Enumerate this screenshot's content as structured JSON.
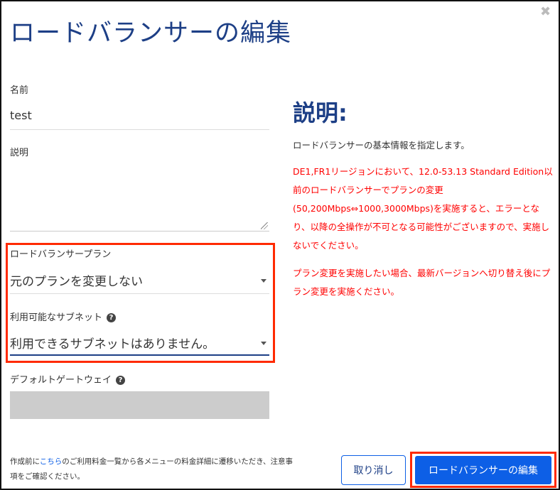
{
  "dialog": {
    "title": "ロードバランサーの編集",
    "close_icon": "✖"
  },
  "form": {
    "name_label": "名前",
    "name_value": "test",
    "description_label": "説明",
    "description_value": "",
    "plan_label": "ロードバランサープラン",
    "plan_value": "元のプランを変更しない",
    "subnet_label": "利用可能なサブネット",
    "subnet_value": "利用できるサブネットはありません。",
    "gateway_label": "デフォルトゲートウェイ",
    "gateway_value": "",
    "help_icon": "?"
  },
  "help": {
    "heading": "説明:",
    "text": "ロードバランサーの基本情報を指定します。",
    "warning1": "DE1,FR1リージョンにおいて、12.0-53.13 Standard Edition以前のロードバランサーでプランの変更(50,200Mbps⇔1000,3000Mbps)を実施すると、エラーとなり、以降の全操作が不可となる可能性がございますので、実施しないでください。",
    "warning2": "プラン変更を実施したい場合、最新バージョンへ切り替え後にプラン変更を実施ください。"
  },
  "footer": {
    "note_before": "作成前に",
    "note_link": "こちら",
    "note_after": "のご利用料金一覧から各メニューの料金詳細に遷移いただき、注意事項をご確認ください。",
    "cancel_label": "取り消し",
    "submit_label": "ロードバランサーの編集"
  },
  "colors": {
    "accent": "#0d5fe6",
    "title": "#1d3f86",
    "warning": "#ff0000",
    "highlight": "#ff2a00"
  }
}
